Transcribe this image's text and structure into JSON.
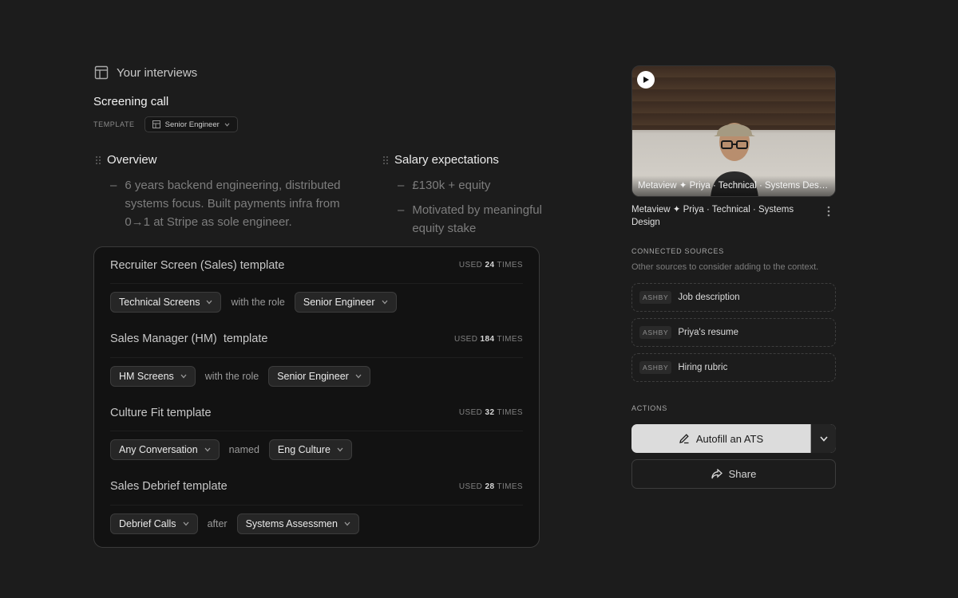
{
  "header": {
    "title": "Your interviews",
    "icon": "layout-icon"
  },
  "call": {
    "title": "Screening call",
    "template_label": "TEMPLATE",
    "template_value": "Senior Engineer"
  },
  "sections": [
    {
      "title": "Overview",
      "bullets": [
        "6 years backend engineering, distributed systems focus. Built payments infra from 0→1 at Stripe as sole engineer."
      ]
    },
    {
      "title": "Salary expectations",
      "bullets": [
        "£130k + equity",
        "Motivated by meaningful equity stake"
      ]
    }
  ],
  "templates": [
    {
      "name": "Recruiter Screen (Sales) template",
      "used_prefix": "USED",
      "used_count": "24",
      "used_suffix": "TIMES",
      "chip1": "Technical Screens",
      "connector": "with the role",
      "chip2": "Senior Engineer"
    },
    {
      "name": "Sales Manager (HM)  template",
      "used_prefix": "USED",
      "used_count": "184",
      "used_suffix": "TIMES",
      "chip1": "HM Screens",
      "connector": "with the role",
      "chip2": "Senior Engineer"
    },
    {
      "name": "Culture Fit template",
      "used_prefix": "USED",
      "used_count": "32",
      "used_suffix": "TIMES",
      "chip1": "Any Conversation",
      "connector": "named",
      "chip2": "Eng Culture"
    },
    {
      "name": "Sales Debrief template",
      "used_prefix": "USED",
      "used_count": "28",
      "used_suffix": "TIMES",
      "chip1": "Debrief Calls",
      "connector": "after",
      "chip2": "Systems Assessmen"
    }
  ],
  "video": {
    "caption": "Metaview ✦ Priya · Technical · Systems Design",
    "title": "Metaview ✦ Priya · Technical · Systems Design"
  },
  "sources": {
    "heading": "CONNECTED SOURCES",
    "subtext": "Other sources to consider adding to the context.",
    "items": [
      {
        "tag": "ASHBY",
        "name": "Job description"
      },
      {
        "tag": "ASHBY",
        "name": "Priya's resume"
      },
      {
        "tag": "ASHBY",
        "name": "Hiring rubric"
      }
    ]
  },
  "actions": {
    "heading": "ACTIONS",
    "autofill_label": "Autofill an ATS",
    "share_label": "Share"
  },
  "colors": {
    "background": "#1c1c1c",
    "panel": "#121212",
    "primary_button": "#dcdcdc"
  }
}
